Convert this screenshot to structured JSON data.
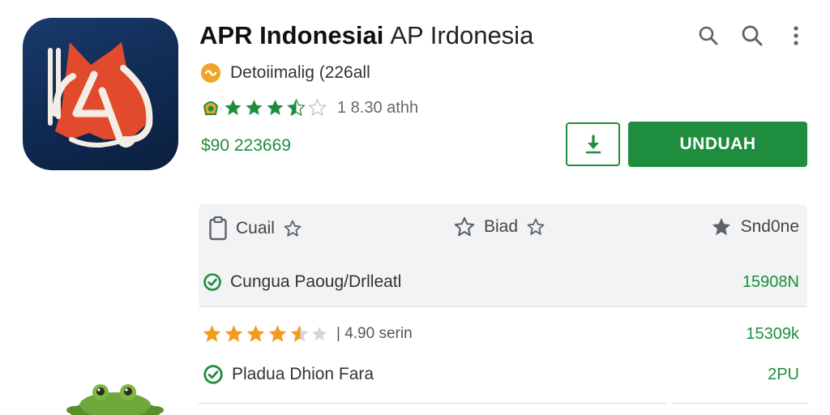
{
  "header": {
    "title_main": "APR Indonesiai",
    "title_sub": "AP Irdonesia",
    "developer": "Detoiimalig (226all",
    "rating_text": "1 8.30 athh",
    "rating_stars": 3.5,
    "price": "$90 223669",
    "install_label": "UNDUAH",
    "top_icons": [
      "search-icon",
      "search-icon",
      "more-vert-icon"
    ],
    "accent_color": "#1e8e3e"
  },
  "panel": {
    "items": [
      {
        "label": "Cuail",
        "icon": "clipboard-icon"
      },
      {
        "label": "Biad",
        "icon": "star-outline-icon"
      },
      {
        "label": "Snd0ne",
        "icon": "star-filled-icon"
      }
    ],
    "row": {
      "label": "Cungua Paoug/Drlleatl",
      "value": "15908N"
    }
  },
  "reviews": [
    {
      "stars": 4.5,
      "text": "| 4.90 serin",
      "value": "15309k"
    },
    {
      "label": "Pladua Dhion Fara",
      "value": "2PU"
    }
  ]
}
